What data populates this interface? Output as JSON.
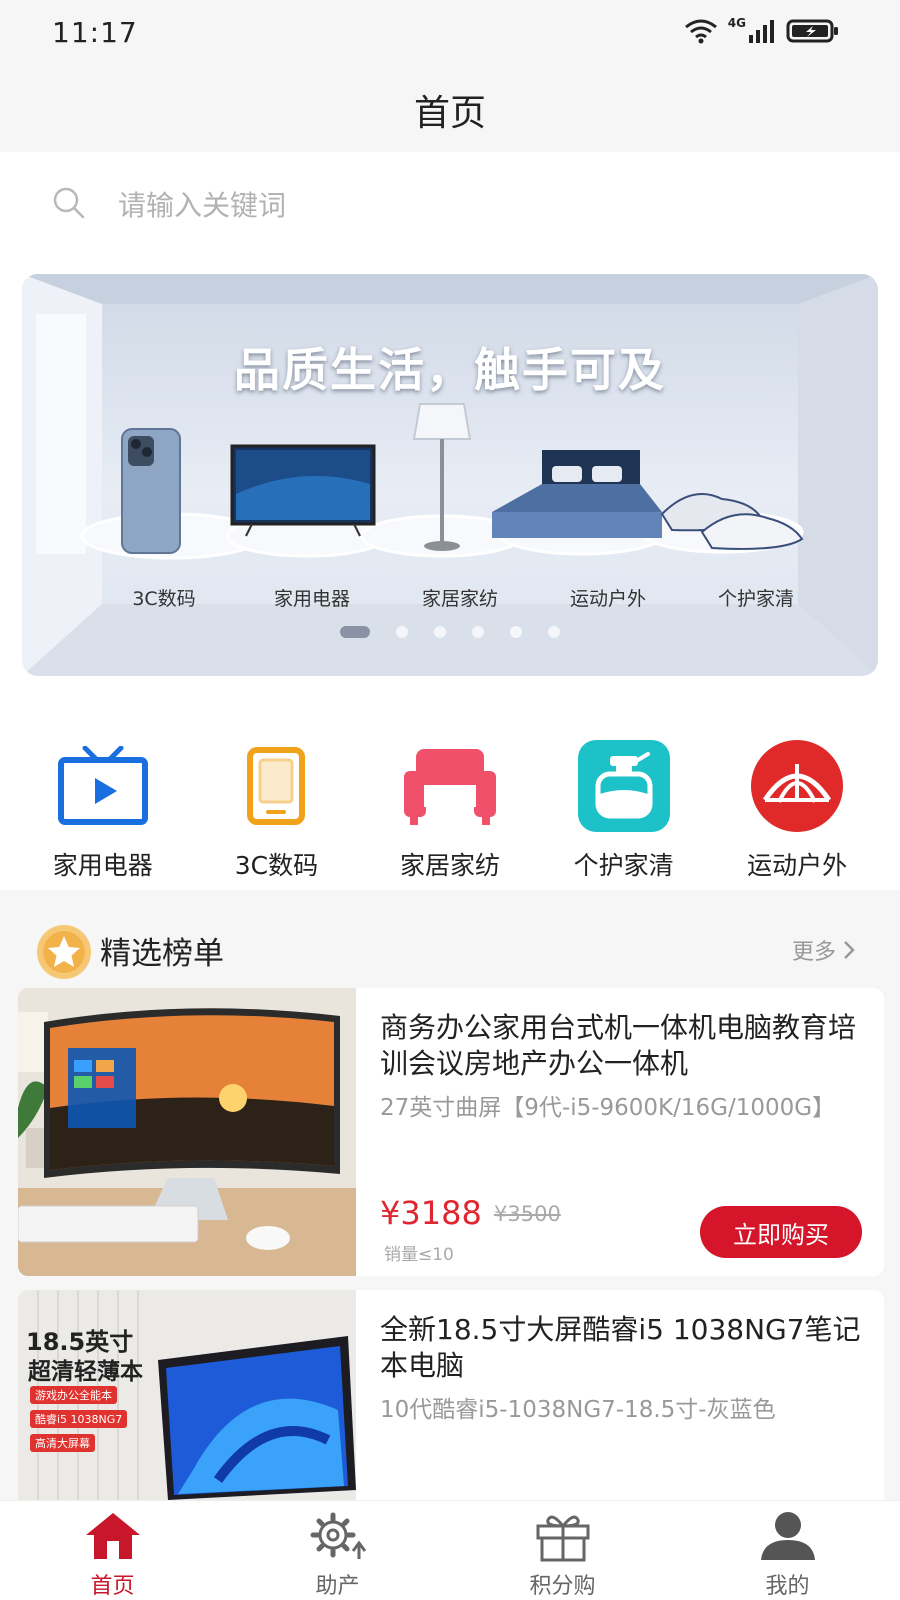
{
  "status": {
    "time": "11:17",
    "network": "4G"
  },
  "header": {
    "title": "首页"
  },
  "search": {
    "placeholder": "请输入关键词"
  },
  "banner": {
    "title": "品质生活，触手可及",
    "labels": [
      "3C数码",
      "家用电器",
      "家居家纺",
      "运动户外",
      "个护家清"
    ],
    "dot_count": 6,
    "active_index": 0
  },
  "categories": [
    {
      "label": "家用电器",
      "icon": "tv-icon",
      "color": "#1a6fe0"
    },
    {
      "label": "3C数码",
      "icon": "tablet-icon",
      "color": "#f0a21a"
    },
    {
      "label": "家居家纺",
      "icon": "sofa-icon",
      "color": "#f0506a"
    },
    {
      "label": "个护家清",
      "icon": "bottle-icon",
      "color": "#1cc2c8"
    },
    {
      "label": "运动户外",
      "icon": "tent-icon",
      "color": "#e02a2a"
    }
  ],
  "ranking": {
    "title": "精选榜单",
    "more": "更多"
  },
  "products": [
    {
      "title": "商务办公家用台式机一体机电脑教育培训会议房地产办公一体机",
      "spec": "27英寸曲屏【9代-i5-9600K/16G/1000G】",
      "price": "¥3188",
      "original_price": "¥3500",
      "sales": "销量≤10",
      "buy_label": "立即购买"
    },
    {
      "title": "全新18.5寸大屏酷睿i5 1038NG7笔记本电脑",
      "spec": "10代酷睿i5-1038NG7-18.5寸-灰蓝色",
      "image_text": {
        "headline": "18.5英寸",
        "subhead": "超清轻薄本",
        "tags": [
          "游戏办公全能本",
          "酷睿i5 1038NG7",
          "高清大屏幕"
        ]
      }
    }
  ],
  "tabbar": [
    {
      "label": "首页",
      "icon": "home-icon",
      "active": true
    },
    {
      "label": "助产",
      "icon": "gear-icon",
      "active": false
    },
    {
      "label": "积分购",
      "icon": "gift-icon",
      "active": false
    },
    {
      "label": "我的",
      "icon": "user-icon",
      "active": false
    }
  ],
  "colors": {
    "accent": "#d5152a",
    "price": "#e02731",
    "background": "#f6f6f6"
  }
}
